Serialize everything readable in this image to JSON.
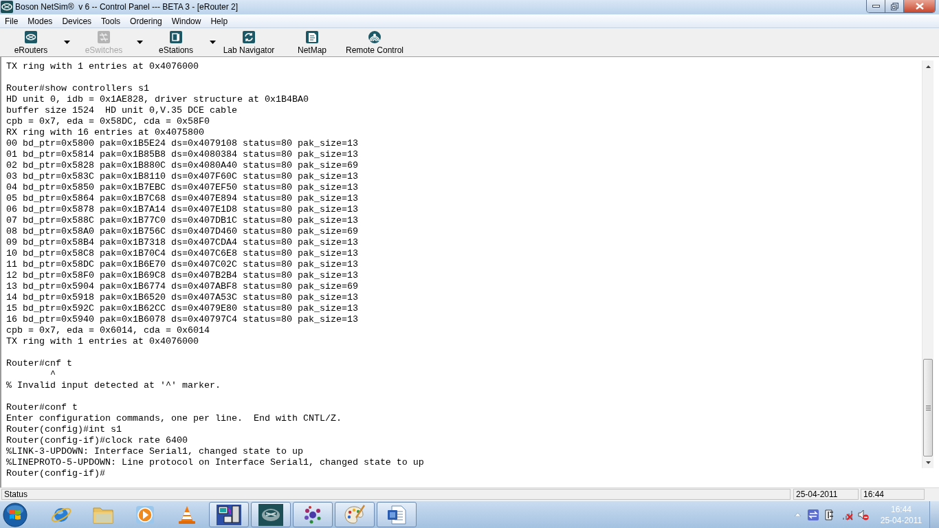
{
  "window": {
    "title": "Boson NetSim®  v 6 -- Control Panel --- BETA 3 - [eRouter 2]"
  },
  "menu": [
    "File",
    "Modes",
    "Devices",
    "Tools",
    "Ordering",
    "Window",
    "Help"
  ],
  "toolbar": [
    {
      "label": "eRouters",
      "kind": "dropdown",
      "disabled": false
    },
    {
      "label": "eSwitches",
      "kind": "dropdown",
      "disabled": true
    },
    {
      "label": "eStations",
      "kind": "dropdown",
      "disabled": false
    },
    {
      "label": "Lab Navigator",
      "kind": "button",
      "disabled": false
    },
    {
      "label": "NetMap",
      "kind": "button",
      "disabled": false
    },
    {
      "label": "Remote Control",
      "kind": "button",
      "disabled": false
    }
  ],
  "terminal": {
    "blocks": [
      [
        "TX ring with 1 entries at 0x4076000"
      ],
      [
        "Router#show controllers s1",
        "HD unit 0, idb = 0x1AE828, driver structure at 0x1B4BA0",
        "buffer size 1524  HD unit 0,V.35 DCE cable",
        "cpb = 0x7, eda = 0x58DC, cda = 0x58F0",
        "RX ring with 16 entries at 0x4075800",
        "00 bd_ptr=0x5800 pak=0x1B5E24 ds=0x4079108 status=80 pak_size=13",
        "01 bd_ptr=0x5814 pak=0x1B85B8 ds=0x4080384 status=80 pak_size=13",
        "02 bd_ptr=0x5828 pak=0x1B880C ds=0x4080A40 status=80 pak_size=69",
        "03 bd_ptr=0x583C pak=0x1B8110 ds=0x407F60C status=80 pak_size=13",
        "04 bd_ptr=0x5850 pak=0x1B7EBC ds=0x407EF50 status=80 pak_size=13",
        "05 bd_ptr=0x5864 pak=0x1B7C68 ds=0x407E894 status=80 pak_size=13",
        "06 bd_ptr=0x5878 pak=0x1B7A14 ds=0x407E1D8 status=80 pak_size=13",
        "07 bd_ptr=0x588C pak=0x1B77C0 ds=0x407DB1C status=80 pak_size=13",
        "08 bd_ptr=0x58A0 pak=0x1B756C ds=0x407D460 status=80 pak_size=69",
        "09 bd_ptr=0x58B4 pak=0x1B7318 ds=0x407CDA4 status=80 pak_size=13",
        "10 bd_ptr=0x58C8 pak=0x1B70C4 ds=0x407C6E8 status=80 pak_size=13",
        "11 bd_ptr=0x58DC pak=0x1B6E70 ds=0x407C02C status=80 pak_size=13",
        "12 bd_ptr=0x58F0 pak=0x1B69C8 ds=0x407B2B4 status=80 pak_size=13",
        "13 bd_ptr=0x5904 pak=0x1B6774 ds=0x407ABF8 status=80 pak_size=69",
        "14 bd_ptr=0x5918 pak=0x1B6520 ds=0x407A53C status=80 pak_size=13",
        "15 bd_ptr=0x592C pak=0x1B62CC ds=0x4079E80 status=80 pak_size=13",
        "16 bd_ptr=0x5940 pak=0x1B6078 ds=0x40797C4 status=80 pak_size=13",
        "cpb = 0x7, eda = 0x6014, cda = 0x6014",
        "TX ring with 1 entries at 0x4076000"
      ],
      [
        "Router#cnf t",
        "        ^",
        "% Invalid input detected at '^' marker."
      ],
      [
        "Router#conf t",
        "Enter configuration commands, one per line.  End with CNTL/Z.",
        "Router(config)#int s1",
        "Router(config-if)#clock rate 6400",
        "%LINK-3-UPDOWN: Interface Serial1, changed state to up",
        "%LINEPROTO-5-UPDOWN: Line protocol on Interface Serial1, changed state to up",
        "Router(config-if)#"
      ]
    ]
  },
  "status_bar": {
    "message": "Status",
    "date": "25-04-2011",
    "time": "16:44"
  },
  "taskbar": {
    "apps": [
      {
        "running": false
      },
      {
        "running": false
      },
      {
        "running": false
      },
      {
        "running": false
      },
      {
        "running": true
      },
      {
        "running": true
      },
      {
        "running": true
      },
      {
        "running": true
      },
      {
        "running": true
      }
    ],
    "clock": {
      "time": "16:44",
      "date": "25-04-2011"
    }
  }
}
